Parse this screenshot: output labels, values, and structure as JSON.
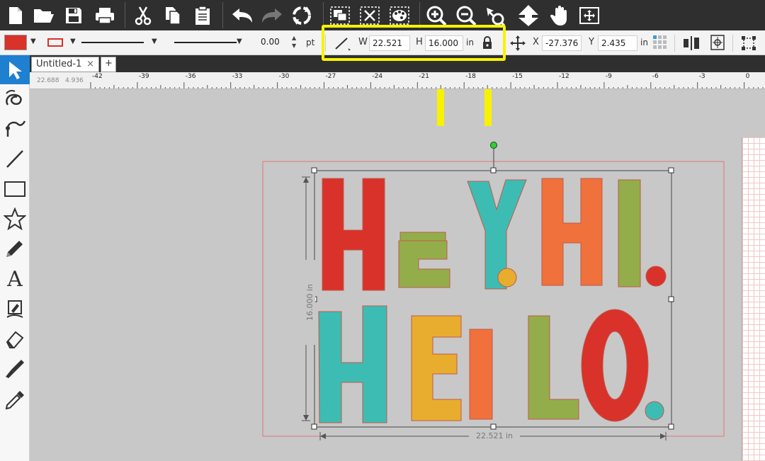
{
  "toolbar": {
    "buttons": [
      "new-document-icon",
      "open-folder-icon",
      "save-icon",
      "print-icon",
      "cut-icon",
      "copy-icon",
      "paste-icon",
      "undo-icon",
      "redo-icon",
      "refresh-icon",
      "group-icon",
      "ungroup-icon",
      "palette-icon",
      "zoom-in-icon",
      "zoom-out-icon",
      "zoom-select-icon",
      "move-down-icon",
      "pan-hand-icon",
      "fit-page-icon"
    ]
  },
  "propbar": {
    "fill_color": "#d8322a",
    "stroke_color": "#d8322a",
    "stroke_width": "0.00",
    "stroke_unit": "pt",
    "width_label": "W",
    "width_value": "22.521",
    "height_label": "H",
    "height_value": "16.000",
    "size_unit": "in",
    "x_label": "X",
    "x_value": "-27.376",
    "y_label": "Y",
    "y_value": "2.435",
    "pos_unit": "in"
  },
  "tabs": {
    "active": "Untitled-1",
    "close": "×",
    "add": "+"
  },
  "ruler": {
    "readout_x": "22.688",
    "readout_y": "4.936",
    "ticks": [
      "-42",
      "-39",
      "-36",
      "-33",
      "-30",
      "-27",
      "-24",
      "-21",
      "-18",
      "-15",
      "-12",
      "-9",
      "-6",
      "-3",
      "0"
    ]
  },
  "canvas": {
    "dimension_width": "22.521 in",
    "dimension_height": "16.000 in",
    "line1": [
      "H",
      "E",
      "Y",
      ".",
      "H",
      "I",
      "."
    ],
    "line2": [
      "H",
      "E",
      "L",
      "L",
      "O",
      "."
    ],
    "colors": {
      "red": "#d8322a",
      "green": "#93ad4b",
      "teal": "#3dbcb4",
      "yellow": "#e8ad2e",
      "orange": "#f0713b"
    }
  },
  "annotation": {
    "highlight_color": "#f8f200"
  }
}
